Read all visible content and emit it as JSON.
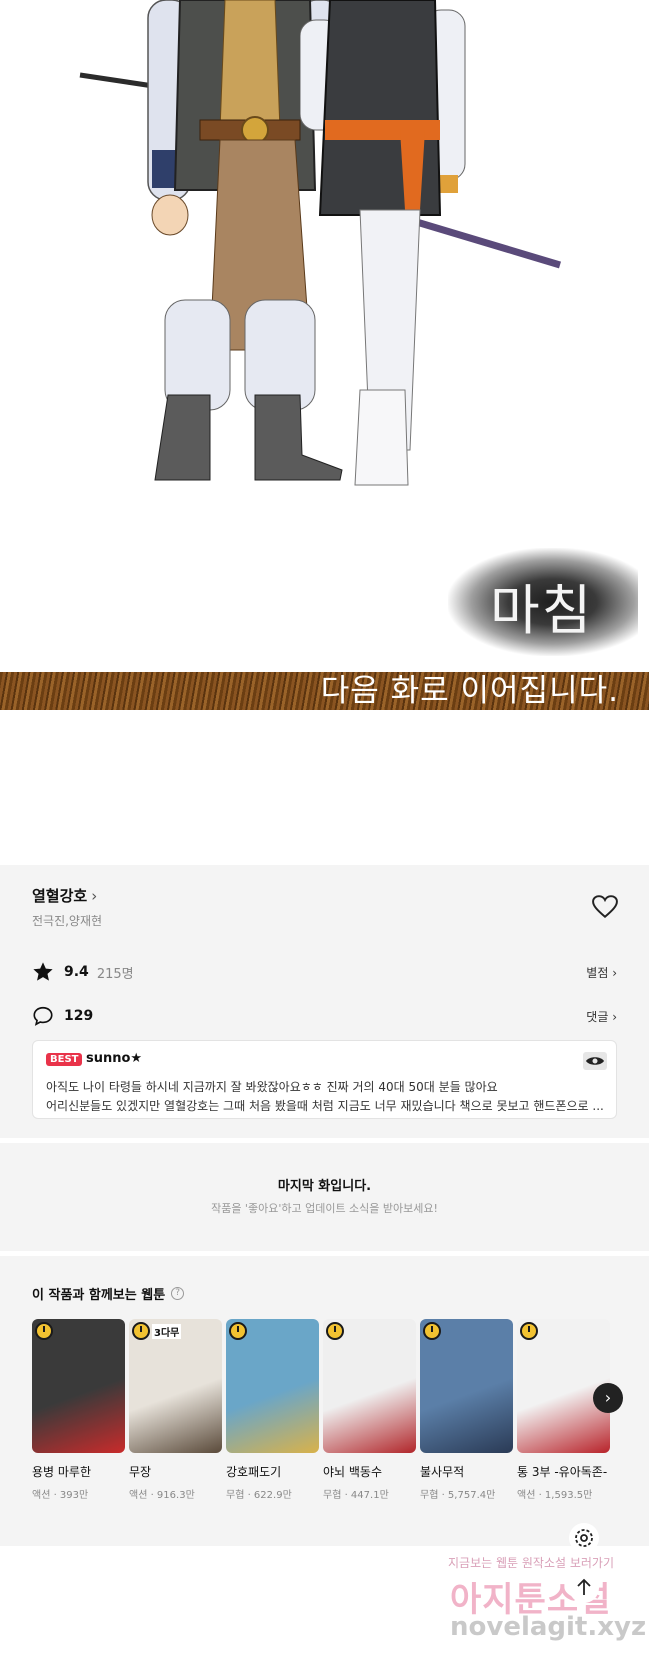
{
  "comic": {
    "ending_word": "마침",
    "band_text": "다음 화로 이어집니다."
  },
  "info": {
    "series_title": "열혈강호",
    "authors": "전극진,양재현",
    "rating": "9.4",
    "rating_count": "215명",
    "rate_link": "별점",
    "comment_count": "129",
    "comment_link": "댓글",
    "best_comment": {
      "badge": "BEST",
      "user": "sunno★",
      "line1": "아직도 나이 타령들 하시네 지금까지 잘 봐왔잖아요ㅎㅎ 진짜 거의 40대 50대 분들 많아요",
      "line2": "어리신분들도 있겠지만 열혈강호는 그때 처음 봤을때 처럼 지금도 너무 재밌습니다 책으로 못보고 핸드폰으로 ..."
    }
  },
  "last_episode": {
    "title": "마지막 화입니다.",
    "subtitle": "작품을 '좋아요'하고 업데이트 소식을 받아보세요!"
  },
  "recommendations": {
    "title": "이 작품과 함께보는 웹툰",
    "items": [
      {
        "title": "용병 마루한",
        "meta": "액션 · 393만",
        "tag": "",
        "bg": "#3a3a3a",
        "accent": "#c92b2b"
      },
      {
        "title": "무장",
        "meta": "액션 · 916.3만",
        "tag": "3다무",
        "bg": "#e7e2da",
        "accent": "#5a4a3a"
      },
      {
        "title": "강호패도기",
        "meta": "무협 · 622.9만",
        "tag": "",
        "bg": "#6aa6c8",
        "accent": "#d9b24a"
      },
      {
        "title": "야뇌 백동수",
        "meta": "무협 · 447.1만",
        "tag": "",
        "bg": "#efefef",
        "accent": "#b1262a"
      },
      {
        "title": "불사무적",
        "meta": "무협 · 5,757.4만",
        "tag": "",
        "bg": "#5b7fa8",
        "accent": "#2a3a55"
      },
      {
        "title": "통 3부 -유아독존-",
        "meta": "액션 · 1,593.5만",
        "tag": "",
        "bg": "#f2f2f2",
        "accent": "#b8232a"
      }
    ]
  },
  "watermark": {
    "line1": "지금보는 웹툰 원작소설 보러가기",
    "line2": "아지툰소설",
    "line3": "novelagit.xyz"
  },
  "colors": {
    "best_badge": "#e9334a",
    "wood_band": "#7a4a1a",
    "panel_bg": "#f4f4f4"
  },
  "icons": [
    "heart-icon",
    "star-icon",
    "comment-icon",
    "eye-icon",
    "question-icon",
    "chevron-right-icon",
    "gear-icon",
    "arrow-up-icon"
  ]
}
